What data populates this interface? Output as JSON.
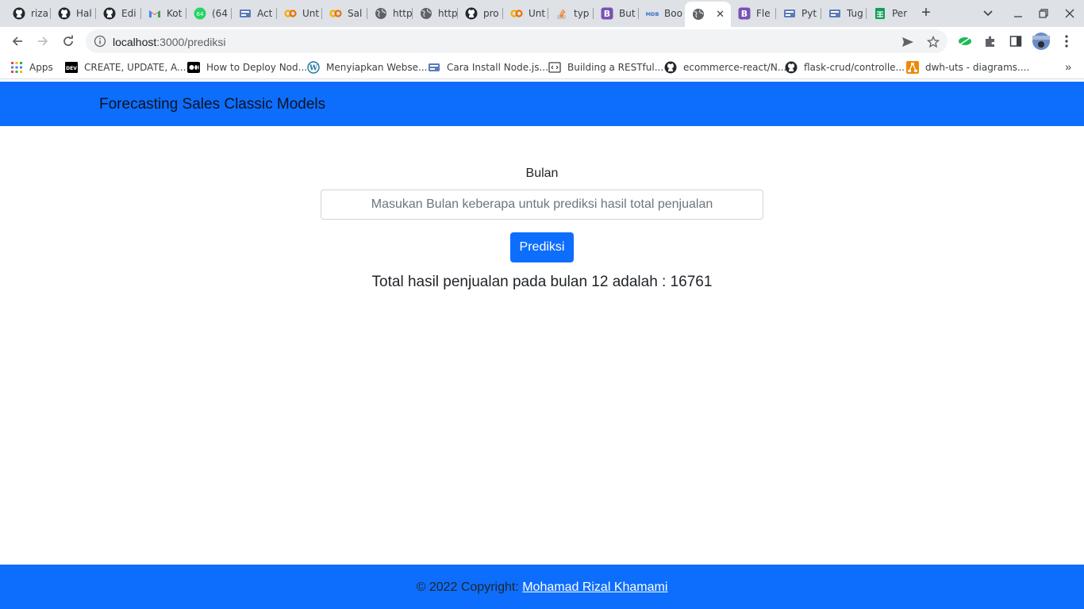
{
  "browser": {
    "tabs": [
      {
        "title": "riza",
        "icon": "github-icon"
      },
      {
        "title": "Hal",
        "icon": "github-icon"
      },
      {
        "title": "Edi",
        "icon": "github-icon"
      },
      {
        "title": "Kot",
        "icon": "gmail-icon"
      },
      {
        "title": "(64",
        "icon": "whatsapp-icon"
      },
      {
        "title": "Act",
        "icon": "site-icon"
      },
      {
        "title": "Unt",
        "icon": "colab-icon"
      },
      {
        "title": "Sal",
        "icon": "colab-icon"
      },
      {
        "title": "http",
        "icon": "globe-icon"
      },
      {
        "title": "http",
        "icon": "globe-icon"
      },
      {
        "title": "pro",
        "icon": "github-icon"
      },
      {
        "title": "Unt",
        "icon": "colab-icon"
      },
      {
        "title": "typ",
        "icon": "stackoverflow-icon"
      },
      {
        "title": "But",
        "icon": "bootstrap-icon"
      },
      {
        "title": "Boo",
        "icon": "mdb-icon"
      },
      {
        "title": "",
        "icon": "globe-icon",
        "active": true
      },
      {
        "title": "Fle",
        "icon": "bootstrap-icon"
      },
      {
        "title": "Pyt",
        "icon": "site-icon"
      },
      {
        "title": "Tug",
        "icon": "site-icon"
      },
      {
        "title": "Per",
        "icon": "sheets-icon"
      }
    ],
    "url_host": "localhost",
    "url_path": ":3000/prediksi",
    "bookmarks": [
      {
        "label": "Apps",
        "icon": "apps-grid-icon"
      },
      {
        "label": "CREATE, UPDATE, A...",
        "icon": "dev-icon"
      },
      {
        "label": "How to Deploy Nod...",
        "icon": "medium-icon"
      },
      {
        "label": "Menyiapkan Webse...",
        "icon": "wordpress-icon"
      },
      {
        "label": "Cara Install Node.js...",
        "icon": "site-icon"
      },
      {
        "label": "Building a RESTful...",
        "icon": "code-icon"
      },
      {
        "label": "ecommerce-react/N...",
        "icon": "github-icon"
      },
      {
        "label": "flask-crud/controlle...",
        "icon": "github-icon"
      },
      {
        "label": "dwh-uts - diagrams....",
        "icon": "drawio-icon"
      }
    ]
  },
  "page": {
    "brand": "Forecasting Sales Classic Models",
    "form_label": "Bulan",
    "input_value": "",
    "input_placeholder": "Masukan Bulan keberapa untuk prediksi hasil total penjualan",
    "submit_label": "Prediksi",
    "result_text": "Total hasil penjualan pada bulan 12 adalah : 16761",
    "footer_prefix": "© 2022 Copyright: ",
    "footer_author": "Mohamad Rizal Khamami"
  },
  "colors": {
    "primary": "#0d6efd",
    "tabstrip": "#dee1e6"
  }
}
